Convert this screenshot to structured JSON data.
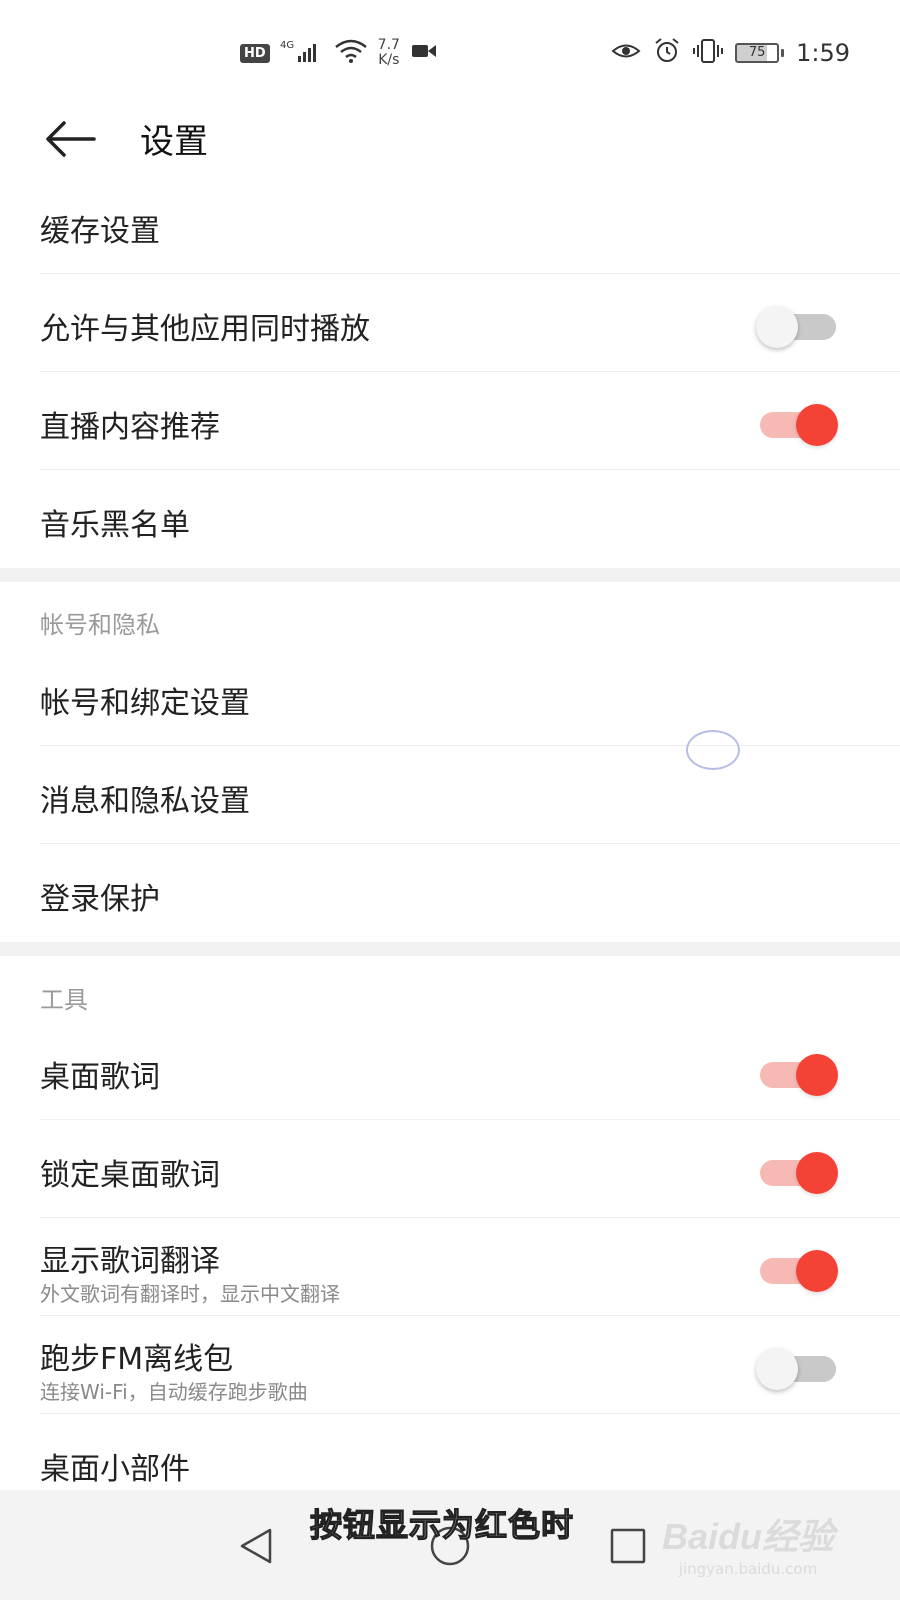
{
  "status_bar": {
    "hd": "HD",
    "network": "4G",
    "speed_value": "7.7",
    "speed_unit": "K/s",
    "battery": "75",
    "time": "1:59"
  },
  "header": {
    "back_icon": "arrow-left-icon",
    "title": "设置"
  },
  "section_general": {
    "items": [
      {
        "label": "缓存设置"
      },
      {
        "label": "允许与其他应用同时播放",
        "toggle": "off"
      },
      {
        "label": "直播内容推荐",
        "toggle": "on"
      },
      {
        "label": "音乐黑名单"
      }
    ]
  },
  "section_account": {
    "title": "帐号和隐私",
    "items": [
      {
        "label": "帐号和绑定设置"
      },
      {
        "label": "消息和隐私设置"
      },
      {
        "label": "登录保护"
      }
    ]
  },
  "section_tools": {
    "title": "工具",
    "items": [
      {
        "label": "桌面歌词",
        "toggle": "on"
      },
      {
        "label": "锁定桌面歌词",
        "toggle": "on"
      },
      {
        "label": "显示歌词翻译",
        "sub": "外文歌词有翻译时，显示中文翻译",
        "toggle": "on"
      },
      {
        "label": "跑步FM离线包",
        "sub": "连接Wi-Fi，自动缓存跑步歌曲",
        "toggle": "off"
      },
      {
        "label": "桌面小部件"
      }
    ]
  },
  "overlay": {
    "caption": "按钮显示为红色时",
    "watermark_logo": "Baidu经验",
    "watermark_url": "jingyan.baidu.com"
  },
  "colors": {
    "accent": "#f44336",
    "accent_track": "#f7b9b3",
    "off_track": "#c9c9c9",
    "section_title": "#9a9a9a"
  }
}
